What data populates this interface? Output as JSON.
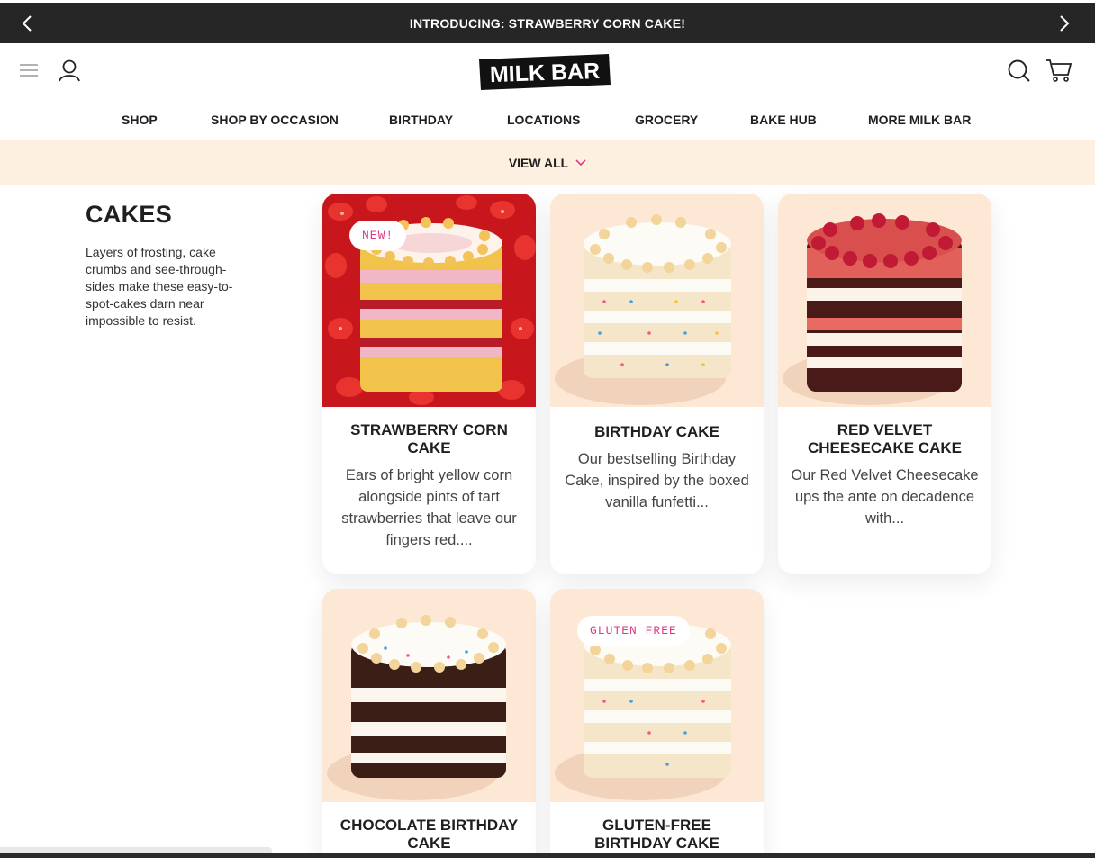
{
  "announcement": {
    "text": "INTRODUCING: STRAWBERRY CORN CAKE!"
  },
  "brand": {
    "logo_text": "MILK BAR"
  },
  "nav": [
    {
      "label": "SHOP"
    },
    {
      "label": "SHOP BY OCCASION"
    },
    {
      "label": "BIRTHDAY"
    },
    {
      "label": "LOCATIONS"
    },
    {
      "label": "GROCERY"
    },
    {
      "label": "BAKE HUB"
    },
    {
      "label": "MORE MILK BAR"
    }
  ],
  "subnav": {
    "label": "VIEW ALL"
  },
  "category": {
    "title": "CAKES",
    "description": "Layers of frosting, cake crumbs and see-through-sides make these easy-to-spot-cakes darn near impossible to resist."
  },
  "products": [
    {
      "title": "STRAWBERRY CORN CAKE",
      "description": "Ears of bright yellow corn alongside pints of tart strawberries that leave our fingers red....",
      "badge": "NEW!"
    },
    {
      "title": "BIRTHDAY CAKE",
      "description": "Our bestselling Birthday Cake, inspired by the boxed vanilla funfetti..."
    },
    {
      "title": "RED VELVET CHEESECAKE CAKE",
      "description": "Our Red Velvet Cheesecake ups the ante on decadence with..."
    },
    {
      "title": "CHOCOLATE BIRTHDAY CAKE",
      "description": ""
    },
    {
      "title": "GLUTEN-FREE BIRTHDAY CAKE",
      "description": "",
      "badge": "GLUTEN FREE"
    }
  ],
  "colors": {
    "announcement_bg": "#262626",
    "subnav_bg": "#fdf0e1",
    "badge_text": "#e03a86",
    "card_image_bg": "#fde8d5",
    "strawberry_bg": "#c8171c"
  },
  "icons": [
    "chevron-left-icon",
    "chevron-right-icon",
    "menu-icon",
    "account-icon",
    "search-icon",
    "cart-icon",
    "chevron-down-icon"
  ]
}
